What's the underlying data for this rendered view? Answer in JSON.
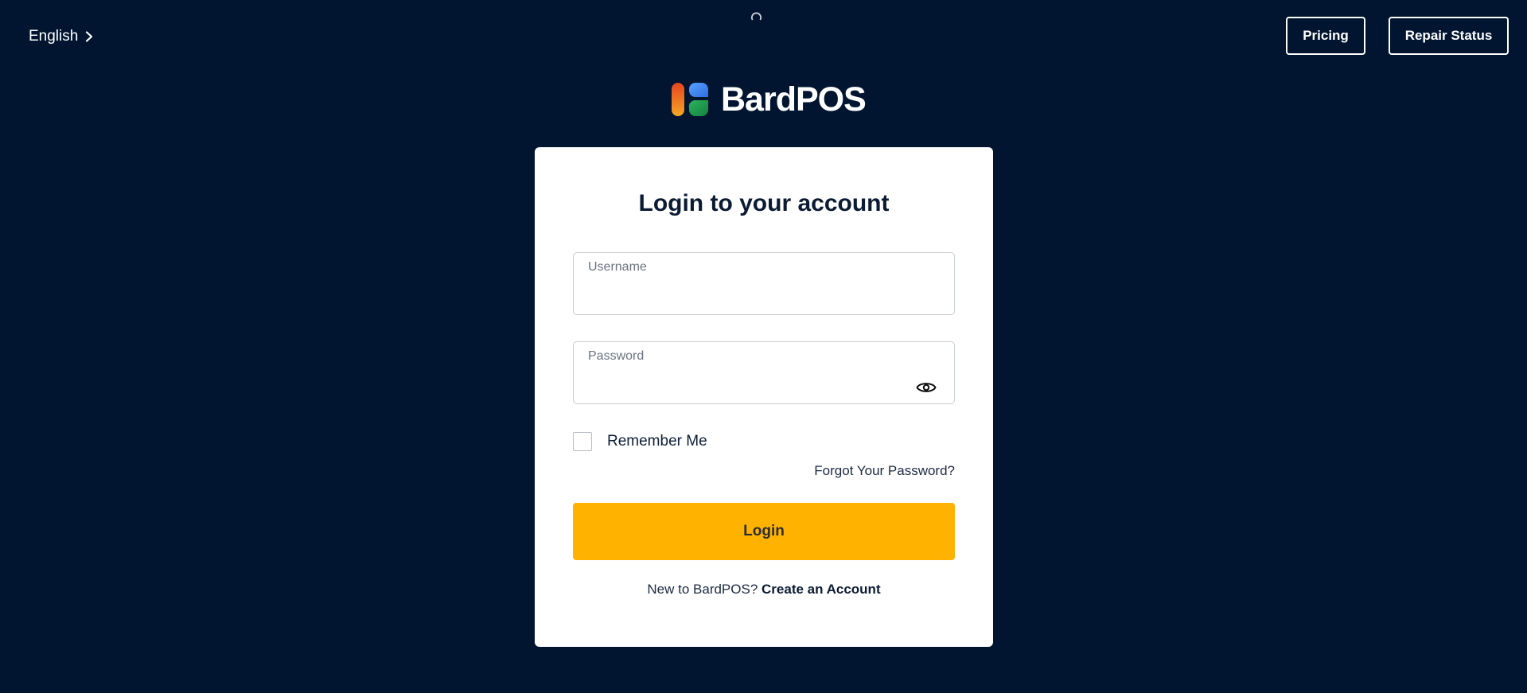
{
  "header": {
    "language_label": "English",
    "pricing_label": "Pricing",
    "repair_status_label": "Repair Status"
  },
  "brand": {
    "name": "BardPOS",
    "logo_colors": [
      "#f5a623",
      "#e8441f",
      "#3b7de8",
      "#1e9a4d"
    ]
  },
  "login": {
    "title": "Login to your account",
    "username_label": "Username",
    "username_value": "",
    "password_label": "Password",
    "password_value": "",
    "remember_label": "Remember Me",
    "remember_checked": false,
    "forgot_label": "Forgot Your Password?",
    "submit_label": "Login",
    "signup_prompt": "New to BardPOS?",
    "signup_link": "Create an Account"
  },
  "icons": {
    "language_chevron": "chevron-right-icon",
    "password_toggle": "eye-icon",
    "loading": "spinner-icon"
  },
  "colors": {
    "background": "#011531",
    "card": "#ffffff",
    "accent": "#ffb300",
    "text_dark": "#0b1b33"
  }
}
